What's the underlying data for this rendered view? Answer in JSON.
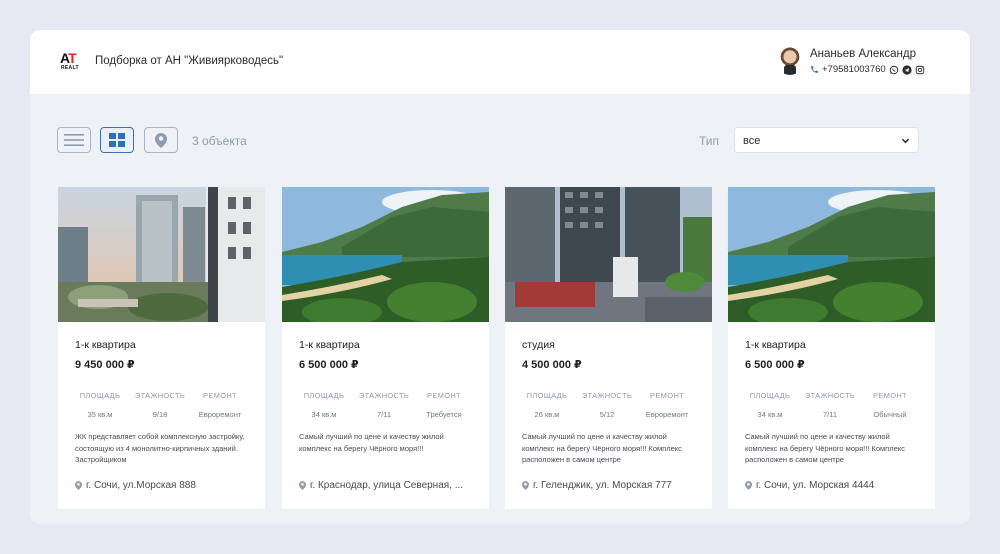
{
  "header": {
    "brand_title": "Подборка от АН \"Живиярководесь\"",
    "agent_name": "Ананьев Александр",
    "agent_phone": "+79581003760"
  },
  "toolbar": {
    "count": "3 объекта",
    "type_label": "Тип",
    "type_value": "все"
  },
  "spec_headers": [
    "ПЛОЩАДЬ",
    "ЭТАЖНОСТЬ",
    "РЕМОНТ"
  ],
  "cards": [
    {
      "kind": "1-к квартира",
      "price": "9 450 000 ₽",
      "area": "35 кв.м",
      "floors": "9/18",
      "repair": "Евроремонт",
      "desc": "ЖК представляет собой комплексную застройку, состоящую из 4 монолитно-кирпичных зданий. Застройщиком",
      "address": "г. Сочи, ул.Морская 888"
    },
    {
      "kind": "1-к квартира",
      "price": "6 500 000 ₽",
      "area": "34 кв.м",
      "floors": "7/11",
      "repair": "Требуется",
      "desc": "Самый лучший по цене и качеству жилой комплекс на берегу Чёрного моря!!!",
      "address": "г. Краснодар, улица Северная, ..."
    },
    {
      "kind": "студия",
      "price": "4 500 000 ₽",
      "area": "26 кв.м",
      "floors": "5/12",
      "repair": "Евроремонт",
      "desc": "Самый лучший по цене и качеству жилой комплекс на берегу Чёрного моря!!! Комплекс расположен в самом центре",
      "address": "г. Геленджик, ул. Морская 777"
    },
    {
      "kind": "1-к квартира",
      "price": "6 500 000 ₽",
      "area": "34 кв.м",
      "floors": "7/11",
      "repair": "Обычный",
      "desc": "Самый лучший по цене и качеству жилой комплекс на берегу Чёрного моря!!! Комплекс расположен в самом центре",
      "address": "г. Сочи, ул. Морская 4444"
    }
  ]
}
